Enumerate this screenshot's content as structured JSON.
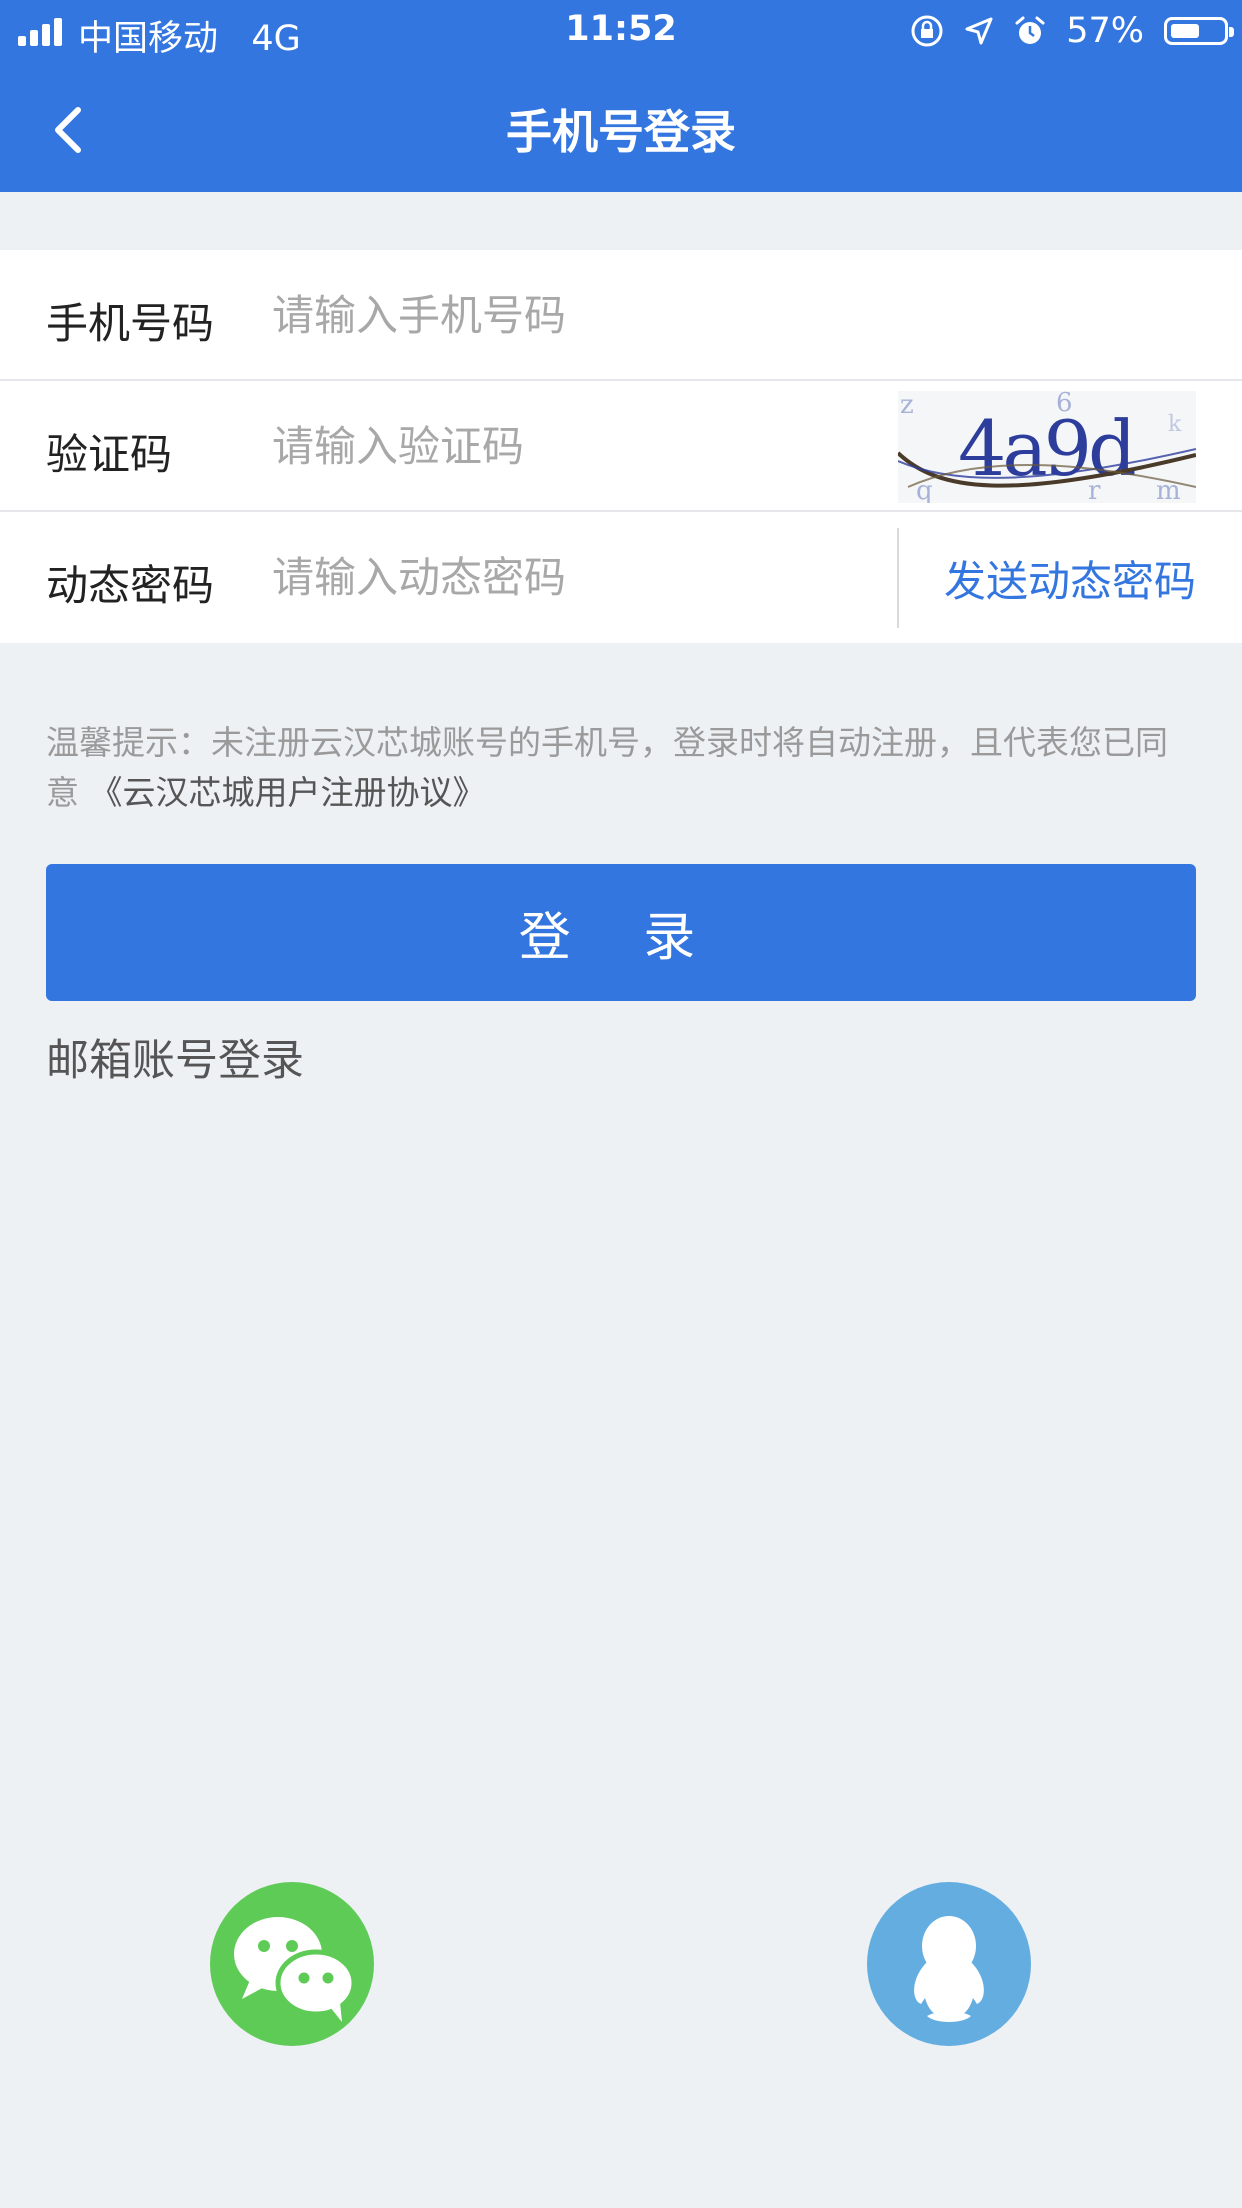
{
  "status_bar": {
    "carrier": "中国移动",
    "network": "4G",
    "time": "11:52",
    "battery_text": "57%",
    "battery_level": 0.57
  },
  "nav": {
    "title": "手机号登录",
    "back_icon": "chevron-left-icon"
  },
  "form": {
    "phone": {
      "label": "手机号码",
      "placeholder": "请输入手机号码",
      "value": ""
    },
    "captcha": {
      "label": "验证码",
      "placeholder": "请输入验证码",
      "value": "",
      "image_text": "4a9d",
      "noise_chars": [
        "z",
        "6",
        "q",
        "r",
        "m",
        "k"
      ]
    },
    "dynamic": {
      "label": "动态密码",
      "placeholder": "请输入动态密码",
      "value": "",
      "send_label": "发送动态密码"
    }
  },
  "tip": {
    "text": "温馨提示：未注册云汉芯城账号的手机号，登录时将自动注册，且代表您已同意",
    "agreement": "《云汉芯城用户注册协议》"
  },
  "login_button": "登 录",
  "email_login": "邮箱账号登录",
  "social": {
    "wechat_icon": "wechat-icon",
    "qq_icon": "qq-icon",
    "colors": {
      "wechat": "#5fcb57",
      "qq": "#63ade0"
    }
  },
  "colors": {
    "primary": "#3476e0",
    "background": "#eef1f4"
  }
}
